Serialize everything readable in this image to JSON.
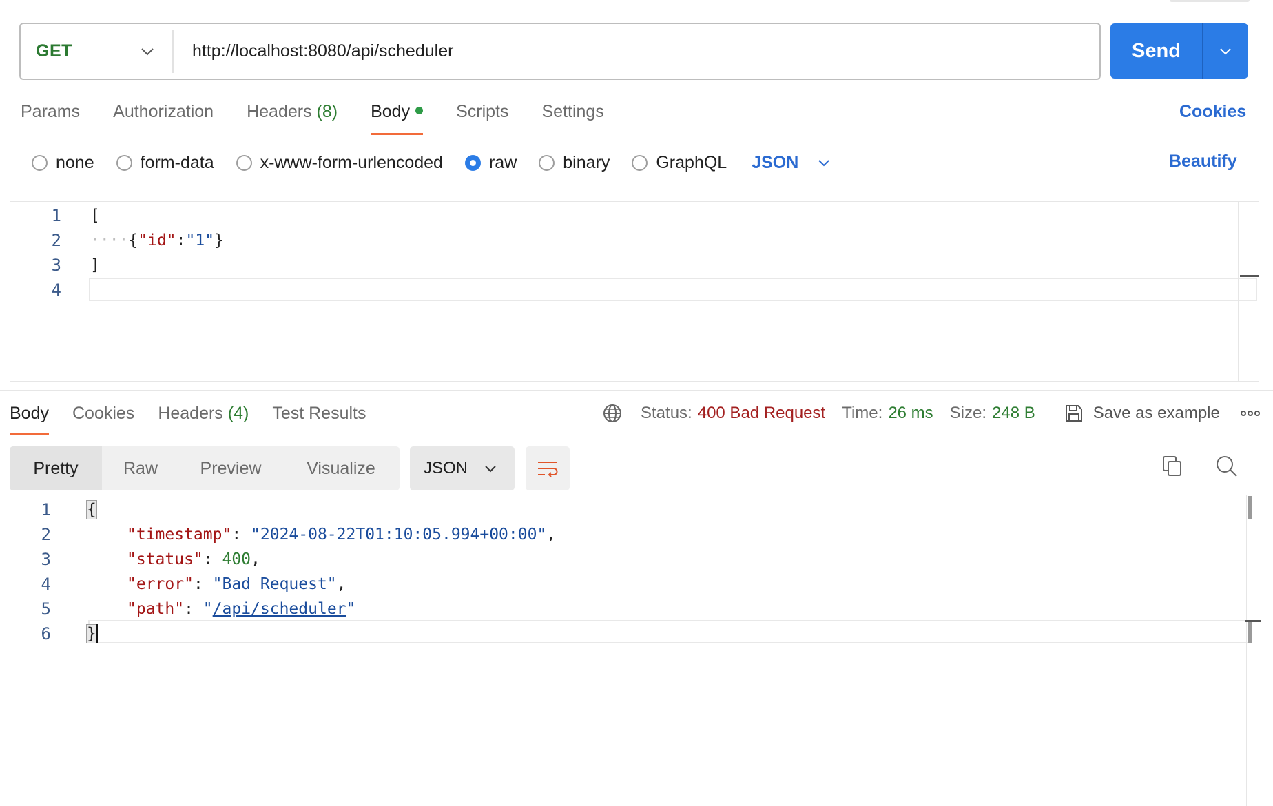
{
  "request": {
    "method": "GET",
    "url": "http://localhost:8080/api/scheduler",
    "send_label": "Send"
  },
  "request_tabs": {
    "params": "Params",
    "authorization": "Authorization",
    "headers": "Headers",
    "headers_count": "(8)",
    "body": "Body",
    "scripts": "Scripts",
    "settings": "Settings",
    "cookies": "Cookies"
  },
  "body_types": {
    "none": "none",
    "form_data": "form-data",
    "urlencoded": "x-www-form-urlencoded",
    "raw": "raw",
    "binary": "binary",
    "graphql": "GraphQL",
    "selected": "raw",
    "language": "JSON",
    "beautify": "Beautify"
  },
  "request_body": {
    "line_numbers": [
      "1",
      "2",
      "3",
      "4"
    ],
    "line1": "[",
    "line2_indent": "····",
    "line2_open": "{",
    "line2_key": "\"id\"",
    "line2_colon": ":",
    "line2_value": "\"1\"",
    "line2_close": "}",
    "line3": "]",
    "line4": ""
  },
  "response_tabs": {
    "body": "Body",
    "cookies": "Cookies",
    "headers": "Headers",
    "headers_count": "(4)",
    "test_results": "Test Results"
  },
  "response_meta": {
    "status_label": "Status:",
    "status_value": "400 Bad Request",
    "time_label": "Time:",
    "time_value": "26 ms",
    "size_label": "Size:",
    "size_value": "248 B",
    "save_example": "Save as example"
  },
  "response_view": {
    "pretty": "Pretty",
    "raw": "Raw",
    "preview": "Preview",
    "visualize": "Visualize",
    "format": "JSON"
  },
  "response_body": {
    "line_numbers": [
      "1",
      "2",
      "3",
      "4",
      "5",
      "6"
    ],
    "open": "{",
    "timestamp_key": "\"timestamp\"",
    "timestamp_value": "\"2024-08-22T01:10:05.994+00:00\"",
    "status_key": "\"status\"",
    "status_value": "400",
    "error_key": "\"error\"",
    "error_value": "\"Bad Request\"",
    "path_key": "\"path\"",
    "path_value": "/api/scheduler",
    "close": "}"
  },
  "colors": {
    "accent": "#2b7ce6",
    "method_green": "#2c7a32",
    "tab_underline": "#f26b3a",
    "status_error": "#a32020"
  }
}
